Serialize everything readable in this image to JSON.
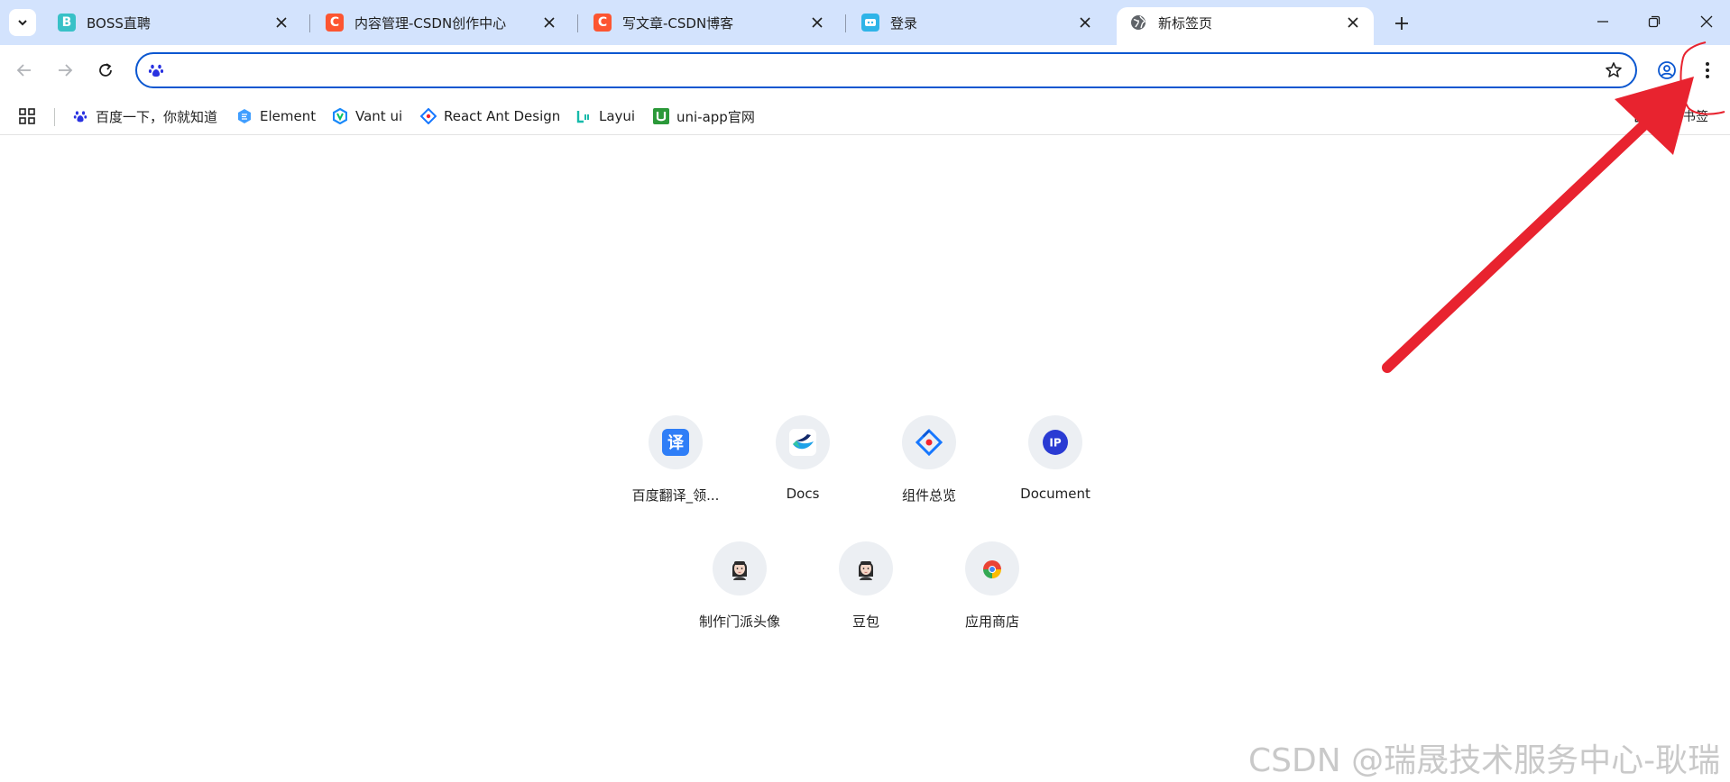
{
  "tabs": [
    {
      "title": "BOSS直聘",
      "favicon": "boss-favicon",
      "favicon_text": "B",
      "favicon_color": "#38c1c7",
      "active": false
    },
    {
      "title": "内容管理-CSDN创作中心",
      "favicon": "csdn-favicon",
      "favicon_text": "C",
      "favicon_color": "#fc5531",
      "active": false
    },
    {
      "title": "写文章-CSDN博客",
      "favicon": "csdn-favicon",
      "favicon_text": "C",
      "favicon_color": "#fc5531",
      "active": false
    },
    {
      "title": "登录",
      "favicon": "login-favicon",
      "favicon_text": "",
      "favicon_color": "#2fb4e8",
      "active": false
    },
    {
      "title": "新标签页",
      "favicon": "globe-icon",
      "favicon_text": "",
      "favicon_color": "#5f6368",
      "active": true
    }
  ],
  "omnibox": {
    "value": "",
    "placeholder": "",
    "engine_icon": "baidu-paw-icon"
  },
  "bookmarks": [
    {
      "label": "百度一下，你就知道",
      "icon": "baidu-paw-icon",
      "color": "#2932e1"
    },
    {
      "label": "Element",
      "icon": "element-icon",
      "color": "#409eff"
    },
    {
      "label": "Vant ui",
      "icon": "vant-icon",
      "color": "#1989fa"
    },
    {
      "label": "React Ant Design",
      "icon": "ant-design-icon",
      "color": "#1677ff"
    },
    {
      "label": "Layui",
      "icon": "layui-icon",
      "color": "#16baaa"
    },
    {
      "label": "uni-app官网",
      "icon": "uniapp-icon",
      "color": "#2b9939"
    }
  ],
  "bookmarks_folder": {
    "label": "所有书签"
  },
  "shortcuts": [
    {
      "label": "百度翻译_领...",
      "icon": "baidu-translate-icon",
      "color": "#2f7ef7"
    },
    {
      "label": "Docs",
      "icon": "docs-icon",
      "color": "#1fa2e8"
    },
    {
      "label": "组件总览",
      "icon": "ant-design-icon",
      "color": "#1677ff"
    },
    {
      "label": "Document",
      "icon": "ip-icon",
      "color": "#2a3bd3"
    },
    {
      "label": "制作门派头像",
      "icon": "avatar-icon",
      "color": "#333333"
    },
    {
      "label": "豆包",
      "icon": "avatar-icon",
      "color": "#333333"
    },
    {
      "label": "应用商店",
      "icon": "chrome-webstore-icon",
      "color": "#ea4335"
    }
  ],
  "watermark": "CSDN @瑞晟技术服务中心-耿瑞",
  "annotation": {
    "color": "#e8232f"
  }
}
